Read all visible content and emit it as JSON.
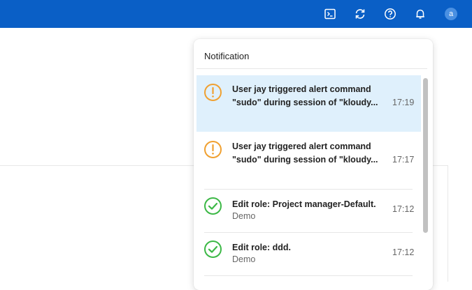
{
  "header": {
    "icons": [
      "terminal-icon",
      "refresh-icon",
      "help-icon",
      "bell-icon"
    ],
    "avatar_letter": "a",
    "brand_color": "#0a5fc6"
  },
  "notification": {
    "title": "Notification",
    "items": [
      {
        "type": "warning",
        "line1": "User jay triggered alert command",
        "line2": "\"sudo\" during session of \"kloudy...",
        "time": "17:19",
        "highlighted": true
      },
      {
        "type": "warning",
        "line1": "User jay triggered alert command",
        "line2": "\"sudo\" during session of \"kloudy...",
        "time": "17:17",
        "highlighted": false
      },
      {
        "type": "success",
        "line1": "Edit role: Project manager-Default.",
        "sub": "Demo",
        "time": "17:12",
        "highlighted": false
      },
      {
        "type": "success",
        "line1": "Edit role: ddd.",
        "sub": "Demo",
        "time": "17:12",
        "highlighted": false
      }
    ]
  },
  "colors": {
    "warning": "#f0a030",
    "success": "#3cb846",
    "highlight": "#dff0fc"
  }
}
